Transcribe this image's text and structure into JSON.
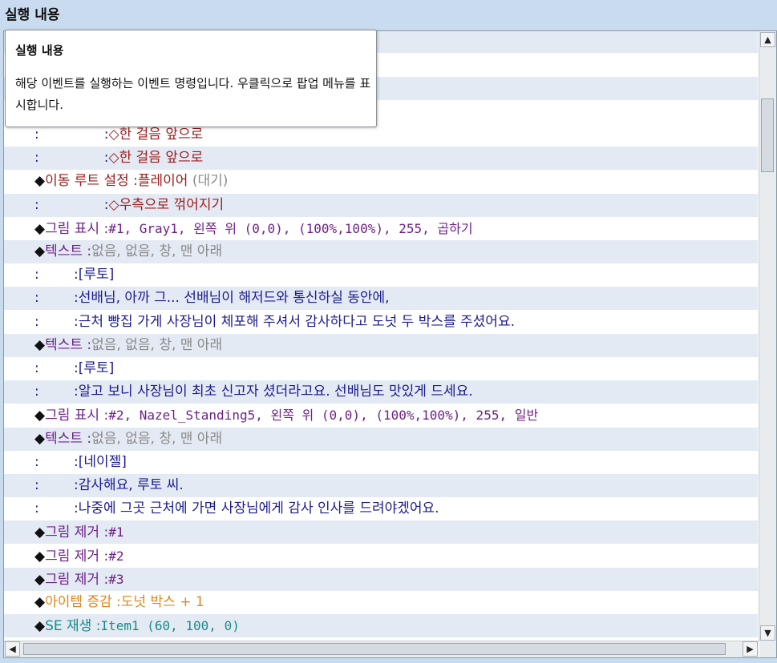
{
  "panel_title": "실행 내용",
  "tooltip": {
    "title": "실행 내용",
    "body": "해당 이벤트를 실행하는 이벤트 명령입니다. 우클릭으로 팝업 메뉴를 표시합니다."
  },
  "rows": [
    {
      "label": ":",
      "pad": "              ",
      "sep": ":",
      "value": "◇한 걸음 앞으로",
      "cls": "c-move"
    },
    {
      "label": ":",
      "pad": "              ",
      "sep": ":",
      "value": "◇한 걸음 앞으로",
      "cls": "c-move"
    },
    {
      "label": "◆이동 루트 설정",
      "sep": ":",
      "value": "플레이어",
      "extra": " (대기)",
      "cls": "c-move"
    },
    {
      "label": ":",
      "pad": "              ",
      "sep": ":",
      "value": "◇우측으로 꺾어지기",
      "cls": "c-move"
    },
    {
      "label": "◆그림 표시",
      "sep": ":",
      "value": "#1, Gray1, 왼쪽 위 (0,0), (100%,100%), 255, 곱하기",
      "cls": "c-pic"
    },
    {
      "label": "◆텍스트",
      "sep": ":",
      "value": "없음, 없음, 창, 맨 아래",
      "cls": "c-text",
      "gray": true
    },
    {
      "label": ":",
      "pad": "       ",
      "sep": ":",
      "value": "[루토]",
      "cls": "c-blue"
    },
    {
      "label": ":",
      "pad": "       ",
      "sep": ":",
      "value": "선배님, 아까 그... 선배님이 해저드와 통신하실 동안에,",
      "cls": "c-blue"
    },
    {
      "label": ":",
      "pad": "       ",
      "sep": ":",
      "value": "근처 빵집 가게 사장님이 체포해 주셔서 감사하다고 도넛 두 박스를 주셨어요.",
      "cls": "c-blue"
    },
    {
      "label": "◆텍스트",
      "sep": ":",
      "value": "없음, 없음, 창, 맨 아래",
      "cls": "c-text",
      "gray": true
    },
    {
      "label": ":",
      "pad": "       ",
      "sep": ":",
      "value": "[루토]",
      "cls": "c-blue"
    },
    {
      "label": ":",
      "pad": "       ",
      "sep": ":",
      "value": "알고 보니 사장님이 최초 신고자 셨더라고요. 선배님도 맛있게 드세요.",
      "cls": "c-blue"
    },
    {
      "label": "◆그림 표시",
      "sep": ":",
      "value": "#2, Nazel_Standing5, 왼쪽 위 (0,0), (100%,100%), 255, 일반",
      "cls": "c-pic"
    },
    {
      "label": "◆텍스트",
      "sep": ":",
      "value": "없음, 없음, 창, 맨 아래",
      "cls": "c-text",
      "gray": true
    },
    {
      "label": ":",
      "pad": "       ",
      "sep": ":",
      "value": "[네이젤]",
      "cls": "c-blue"
    },
    {
      "label": ":",
      "pad": "       ",
      "sep": ":",
      "value": "감사해요, 루토 씨.",
      "cls": "c-blue"
    },
    {
      "label": ":",
      "pad": "       ",
      "sep": ":",
      "value": "나중에 그곳 근처에 가면 사장님에게 감사 인사를 드려야겠어요.",
      "cls": "c-blue"
    },
    {
      "label": "◆그림 제거",
      "sep": ":",
      "value": "#1",
      "cls": "c-pic"
    },
    {
      "label": "◆그림 제거",
      "sep": ":",
      "value": "#2",
      "cls": "c-pic"
    },
    {
      "label": "◆그림 제거",
      "sep": ":",
      "value": "#3",
      "cls": "c-pic"
    },
    {
      "label": "◆아이템 증감",
      "sep": ":",
      "value": "도넛 박스 + 1",
      "cls": "c-item"
    },
    {
      "label": "◆SE 재생",
      "sep": ":",
      "value": "Item1 (60, 100, 0)",
      "cls": "c-se"
    }
  ],
  "scroll": {
    "up_icon": "▲",
    "down_icon": "▼",
    "left_icon": "◀",
    "right_icon": "▶"
  }
}
